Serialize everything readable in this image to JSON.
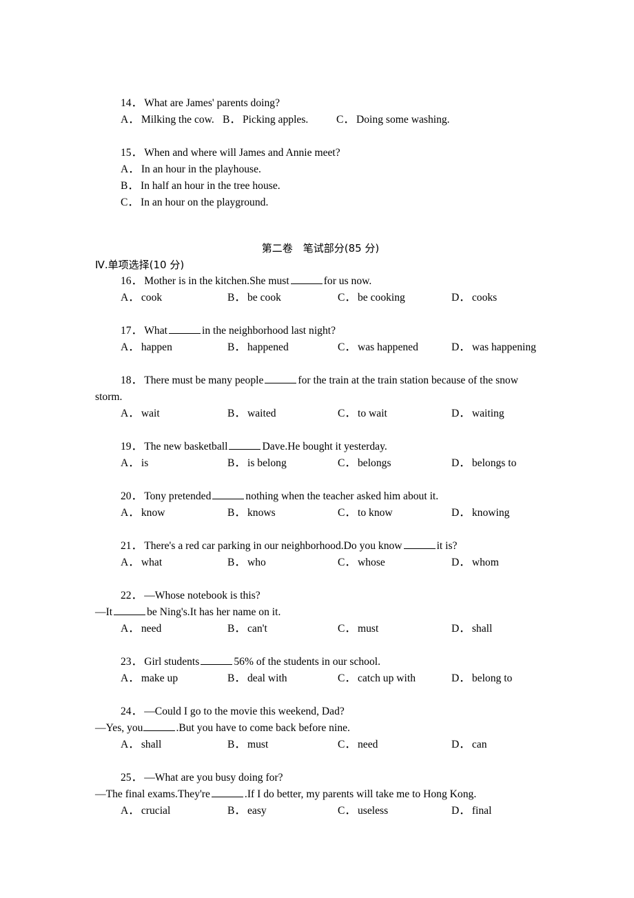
{
  "page": {
    "background": "#ffffff",
    "text_color": "#000000"
  },
  "listening_questions": [
    {
      "number": "14．",
      "stem": "What are James' parents doing?",
      "layout": "inline3",
      "options": [
        {
          "letter": "A．",
          "text": "Milking the cow."
        },
        {
          "letter": "B．",
          "text": "Picking apples."
        },
        {
          "letter": "C．",
          "text": "Doing some washing."
        }
      ]
    },
    {
      "number": "15．",
      "stem": "When and where will James and Annie meet?",
      "layout": "stacked",
      "options": [
        {
          "letter": "A．",
          "text": "In an hour in the playhouse."
        },
        {
          "letter": "B．",
          "text": "In half an hour in the tree house."
        },
        {
          "letter": "C．",
          "text": "In an hour on the playground."
        }
      ]
    }
  ],
  "volume_heading": "第二卷　笔试部分(85 分)",
  "section_heading": "Ⅳ.单项选择(10 分)",
  "questions": [
    {
      "number": "16．",
      "stem_before": "Mother is in the kitchen.She must",
      "stem_after": "for us now.",
      "options": [
        {
          "letter": "A．",
          "text": "cook"
        },
        {
          "letter": "B．",
          "text": "be cook"
        },
        {
          "letter": "C．",
          "text": "be cooking"
        },
        {
          "letter": "D．",
          "text": "cooks"
        }
      ]
    },
    {
      "number": "17．",
      "stem_before": "What",
      "stem_after": "in the neighborhood last night?",
      "options": [
        {
          "letter": "A．",
          "text": "happen"
        },
        {
          "letter": "B．",
          "text": "happened"
        },
        {
          "letter": "C．",
          "text": "was happened"
        },
        {
          "letter": "D．",
          "text": "was happening"
        }
      ]
    },
    {
      "number": "18．",
      "stem_before": "There must be many people",
      "stem_after": "for the train at the train station because of the snow storm.",
      "options": [
        {
          "letter": "A．",
          "text": "wait"
        },
        {
          "letter": "B．",
          "text": "waited"
        },
        {
          "letter": "C．",
          "text": "to wait"
        },
        {
          "letter": "D．",
          "text": "waiting"
        }
      ]
    },
    {
      "number": "19．",
      "stem_before": "The new basketball",
      "stem_after": "Dave.He bought it yesterday.",
      "options": [
        {
          "letter": "A．",
          "text": "is"
        },
        {
          "letter": "B．",
          "text": "is belong"
        },
        {
          "letter": "C．",
          "text": "belongs"
        },
        {
          "letter": "D．",
          "text": "belongs to"
        }
      ]
    },
    {
      "number": "20．",
      "stem_before": "Tony pretended",
      "stem_after": "nothing when the teacher asked him about it.",
      "options": [
        {
          "letter": "A．",
          "text": "know"
        },
        {
          "letter": "B．",
          "text": "knows"
        },
        {
          "letter": "C．",
          "text": "to know"
        },
        {
          "letter": "D．",
          "text": "knowing"
        }
      ]
    },
    {
      "number": "21．",
      "stem_before": "There's a red car parking in our neighborhood.Do you know",
      "stem_after": "it is?",
      "options": [
        {
          "letter": "A．",
          "text": "what"
        },
        {
          "letter": "B．",
          "text": "who"
        },
        {
          "letter": "C．",
          "text": "whose"
        },
        {
          "letter": "D．",
          "text": "whom"
        }
      ]
    },
    {
      "number": "22．",
      "dialog_q": "—Whose notebook is this?",
      "reply_before": "—It",
      "reply_after": "be Ning's.It has her name on it.",
      "options": [
        {
          "letter": "A．",
          "text": "need"
        },
        {
          "letter": "B．",
          "text": "can't"
        },
        {
          "letter": "C．",
          "text": "must"
        },
        {
          "letter": "D．",
          "text": "shall"
        }
      ]
    },
    {
      "number": "23．",
      "stem_before": "Girl students",
      "stem_after": "56% of the students in our school.",
      "options": [
        {
          "letter": "A．",
          "text": "make up"
        },
        {
          "letter": "B．",
          "text": "deal with"
        },
        {
          "letter": "C．",
          "text": "catch up with"
        },
        {
          "letter": "D．",
          "text": "belong to"
        }
      ]
    },
    {
      "number": "24．",
      "dialog_q": "—Could I go to the movie this weekend, Dad?",
      "reply_before": "—Yes, you",
      "reply_after": ".But you have to come back before nine.",
      "options": [
        {
          "letter": "A．",
          "text": "shall"
        },
        {
          "letter": "B．",
          "text": "must"
        },
        {
          "letter": "C．",
          "text": "need"
        },
        {
          "letter": "D．",
          "text": "can"
        }
      ]
    },
    {
      "number": "25．",
      "dialog_q": "—What are you busy doing for?",
      "reply_before": "—The final exams.They're",
      "reply_after": ".If I do better, my parents will take me to Hong Kong.",
      "options": [
        {
          "letter": "A．",
          "text": "crucial"
        },
        {
          "letter": "B．",
          "text": "easy"
        },
        {
          "letter": "C．",
          "text": "useless"
        },
        {
          "letter": "D．",
          "text": "final"
        }
      ]
    }
  ]
}
